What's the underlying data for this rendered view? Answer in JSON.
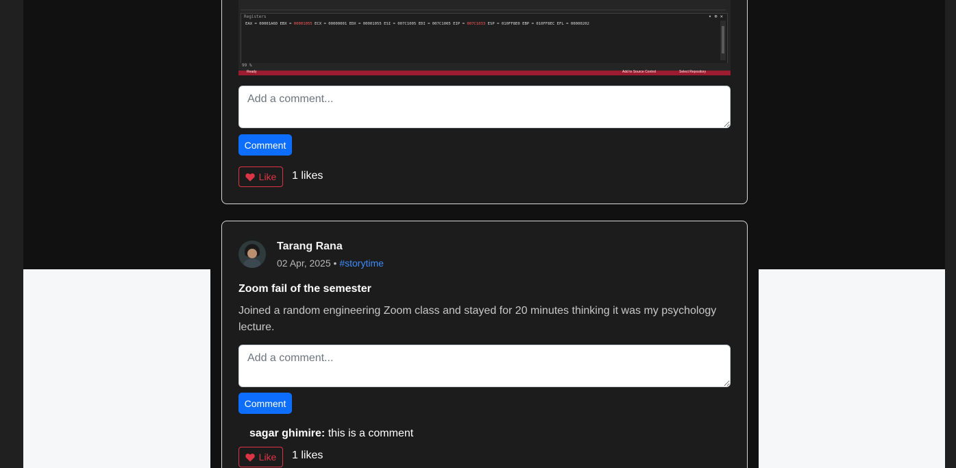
{
  "colors": {
    "page_bg": "#202020",
    "card_bg": "#1c1c1c",
    "primary": "#0d6efd",
    "danger": "#dc3545",
    "tag": "#3d8bfd"
  },
  "post1": {
    "image": {
      "registers_title": "Registers",
      "register_parts": [
        "EAX = 00001A6D EBX = ",
        "00001055",
        " ECX = 00000001 EDX = 00001055 ESI = 007C1005 EDI = 007C1005 EIP = ",
        "007C1033",
        " ESP = 010FF8E0 EBP = 010FF8EC EFL = 00000202"
      ],
      "zoom_level": "99 %",
      "status_left": "Ready",
      "status_source_control": "Add to Source Control",
      "status_repository": "Select Repository"
    },
    "comment_placeholder": "Add a comment...",
    "comment_button": "Comment",
    "like_label": "Like",
    "likes_text": "1 likes"
  },
  "post2": {
    "author": "Tarang Rana",
    "date": "02 Apr, 2025",
    "separator": "•",
    "tag": "#storytime",
    "title": "Zoom fail of the semester",
    "body": "Joined a random engineering Zoom class and stayed for 20 minutes thinking it was my psychology lecture.",
    "comment_placeholder": "Add a comment...",
    "comment_button": "Comment",
    "comments": [
      {
        "user": "sagar ghimire:",
        "text": " this is a comment"
      }
    ],
    "like_label": "Like",
    "likes_text": "1 likes"
  }
}
